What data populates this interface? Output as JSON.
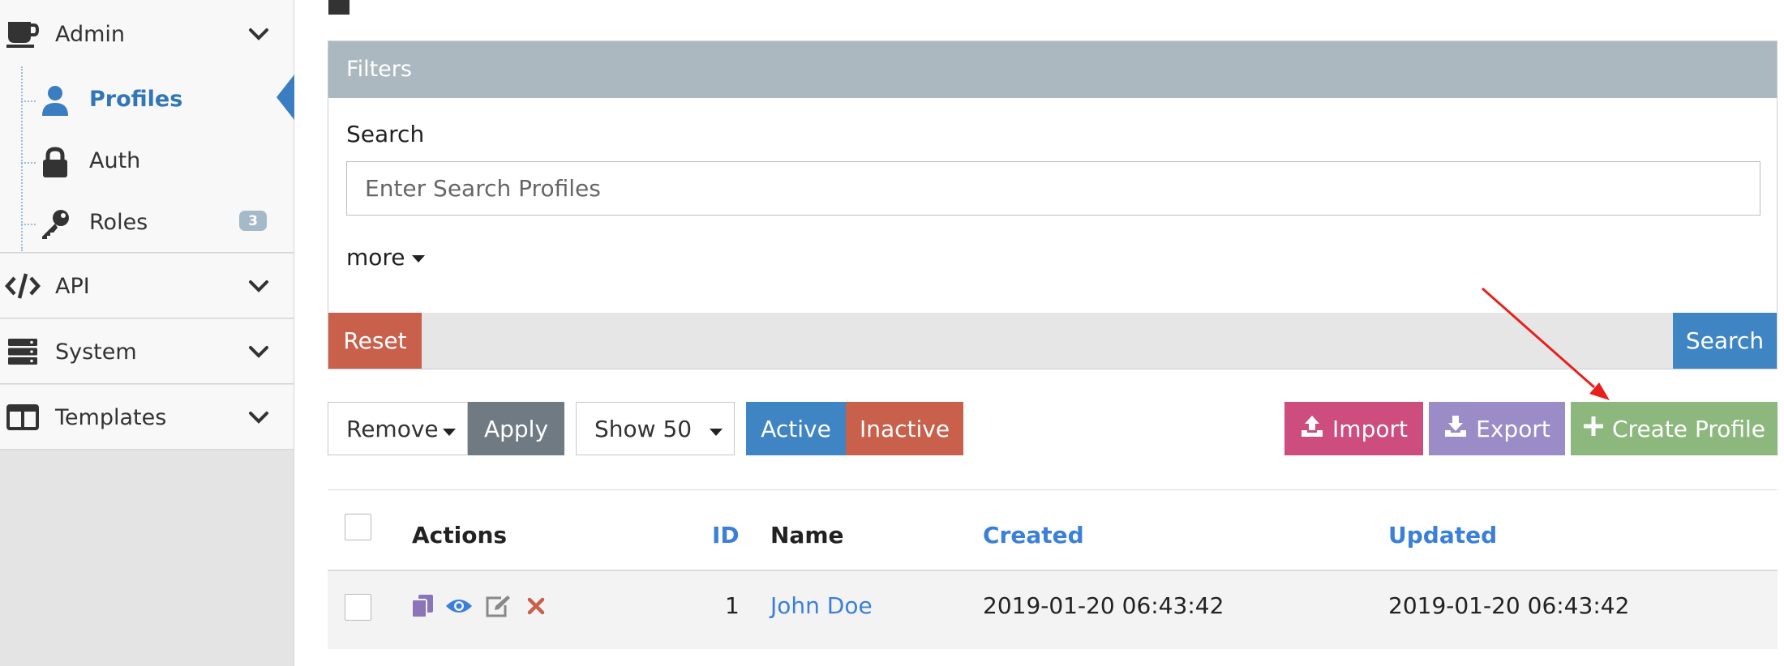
{
  "sidebar": {
    "sections": [
      {
        "label": "Admin",
        "icon": "coffee-icon"
      },
      {
        "label": "API",
        "icon": "code-icon"
      },
      {
        "label": "System",
        "icon": "server-icon"
      },
      {
        "label": "Templates",
        "icon": "columns-icon"
      }
    ],
    "admin_items": [
      {
        "label": "Profiles",
        "icon": "user-icon",
        "active": true
      },
      {
        "label": "Auth",
        "icon": "lock-icon"
      },
      {
        "label": "Roles",
        "icon": "key-icon",
        "badge": "3"
      }
    ]
  },
  "filters": {
    "title": "Filters",
    "search_label": "Search",
    "search_placeholder": "Enter Search Profiles",
    "search_value": "",
    "more_label": "more",
    "reset_label": "Reset",
    "search_button_label": "Search"
  },
  "toolbar": {
    "bulk_action": "Remove",
    "apply_label": "Apply",
    "page_size": "Show 50",
    "active_label": "Active",
    "inactive_label": "Inactive",
    "import_label": "Import",
    "export_label": "Export",
    "create_label": "Create Profile"
  },
  "table": {
    "columns": [
      "Actions",
      "ID",
      "Name",
      "Created",
      "Updated"
    ],
    "rows": [
      {
        "id": "1",
        "name": "John Doe",
        "created": "2019-01-20 06:43:42",
        "updated": "2019-01-20 06:43:42"
      }
    ]
  },
  "colors": {
    "accent": "#3f85c4",
    "danger": "#c8604c",
    "import": "#cc4d7e",
    "export": "#9b8bc6",
    "create": "#8cb87d",
    "annotation": "#e8201c"
  }
}
